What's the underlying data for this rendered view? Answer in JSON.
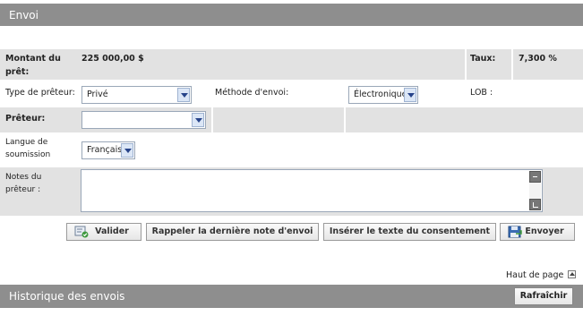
{
  "header": {
    "title": "Envoi"
  },
  "loan": {
    "amount_label": "Montant du prêt:",
    "amount_value": "225 000,00 $",
    "rate_label": "Taux:",
    "rate_value": "7,300 %"
  },
  "lender_type": {
    "label": "Type de prêteur:",
    "selected": "Privé"
  },
  "send_method": {
    "label": "Méthode d'envoi:",
    "selected": "Électronique"
  },
  "lob": {
    "label": "LOB :",
    "value": ""
  },
  "lender": {
    "label": "Prêteur:",
    "selected": ""
  },
  "language": {
    "label": "Langue de soumission",
    "selected": "Français"
  },
  "notes": {
    "label": "Notes du prêteur :",
    "value": ""
  },
  "buttons": {
    "validate": "Valider",
    "recall": "Rappeler la dernière note d'envoi",
    "insert_consent": "Insérer le texte du consentement",
    "send": "Envoyer"
  },
  "back_to_top": "Haut de page",
  "history": {
    "title": "Historique des envois",
    "refresh": "Rafraîchir"
  },
  "colors": {
    "header_bg": "#8e8e8e",
    "row_grey": "#e2e2e2",
    "select_border": "#9aa7b8"
  },
  "icons": [
    "chevron-down-icon",
    "validate-icon",
    "send-icon",
    "arrow-up-icon"
  ]
}
